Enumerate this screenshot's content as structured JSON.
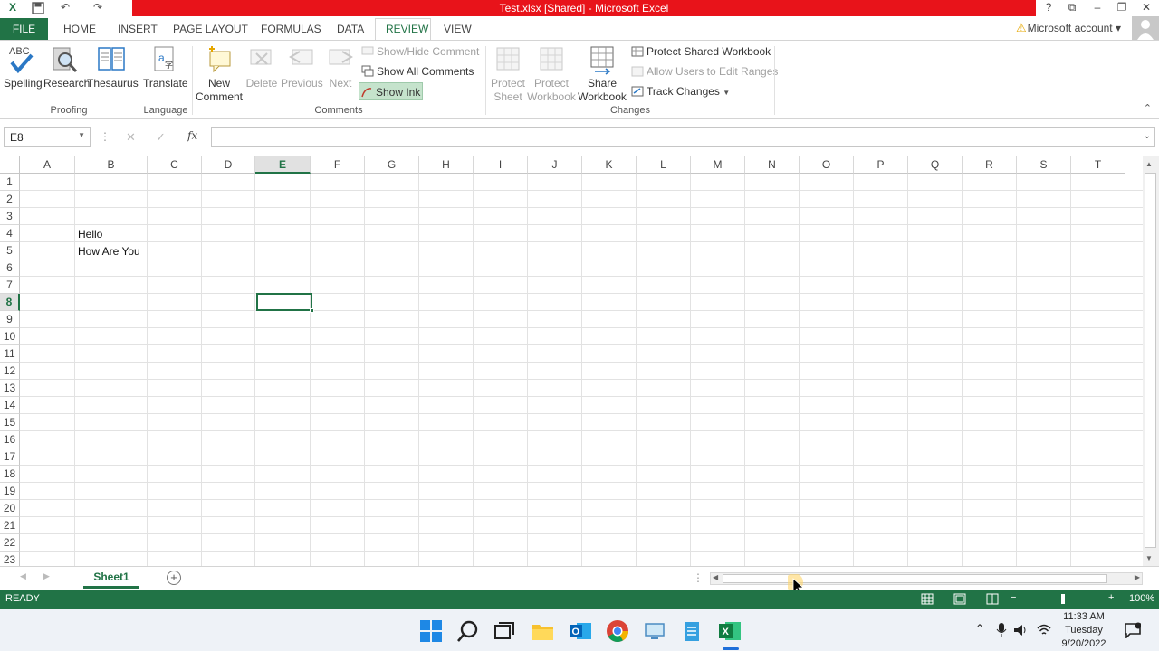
{
  "window": {
    "title": "Test.xlsx  [Shared] -  Microsoft Excel"
  },
  "tabs": {
    "file": "FILE",
    "items": [
      "HOME",
      "INSERT",
      "PAGE LAYOUT",
      "FORMULAS",
      "DATA",
      "REVIEW",
      "VIEW"
    ],
    "active": "REVIEW",
    "account": "Microsoft account"
  },
  "ribbon": {
    "proofing": {
      "spelling": "Spelling",
      "research": "Research",
      "thesaurus": "Thesaurus",
      "abc": "ABC",
      "group": "Proofing"
    },
    "language": {
      "translate": "Translate",
      "group": "Language"
    },
    "comments": {
      "new_comment": "New Comment",
      "delete": "Delete",
      "previous": "Previous",
      "next": "Next",
      "show_hide": "Show/Hide Comment",
      "show_all": "Show All Comments",
      "show_ink": "Show Ink",
      "group": "Comments"
    },
    "changes": {
      "protect_sheet": "Protect Sheet",
      "protect_workbook": "Protect Workbook",
      "share_workbook": "Share Workbook",
      "protect_shared": "Protect Shared Workbook",
      "allow_users": "Allow Users to Edit Ranges",
      "track_changes": "Track Changes",
      "group": "Changes"
    }
  },
  "formula_bar": {
    "name_box": "E8",
    "fx": "fx",
    "value": ""
  },
  "grid": {
    "columns": [
      "A",
      "B",
      "C",
      "D",
      "E",
      "F",
      "G",
      "H",
      "I",
      "J",
      "K",
      "L",
      "M",
      "N",
      "O",
      "P",
      "Q",
      "R",
      "S",
      "T"
    ],
    "rows": [
      "1",
      "2",
      "3",
      "4",
      "5",
      "6",
      "7",
      "8",
      "9",
      "10",
      "11",
      "12",
      "13",
      "14",
      "15",
      "16",
      "17",
      "18",
      "19",
      "20",
      "21",
      "22",
      "23"
    ],
    "selected_cell": "E8",
    "cells": {
      "B4": "Hello",
      "B5": "How Are You"
    }
  },
  "sheets": {
    "tabs": [
      "Sheet1"
    ],
    "active": "Sheet1"
  },
  "status": {
    "mode": "READY",
    "zoom": "100%"
  },
  "taskbar": {
    "time": "11:33 AM",
    "day": "Tuesday",
    "date": "9/20/2022"
  },
  "colors": {
    "excel_green": "#217346",
    "title_red": "#e8131a"
  }
}
